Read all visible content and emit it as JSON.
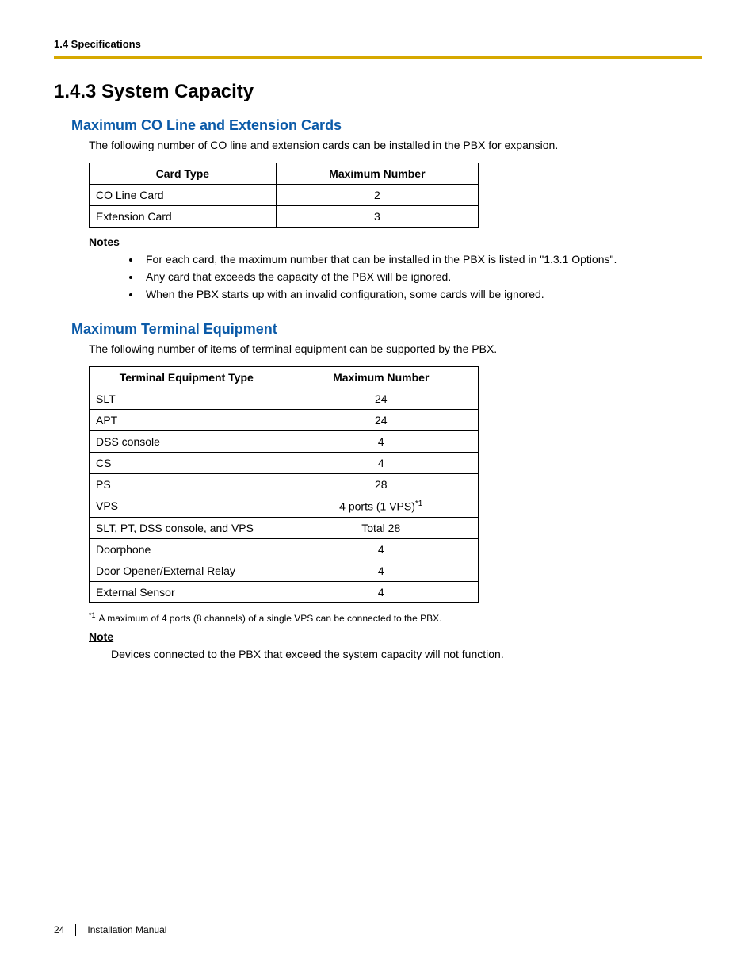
{
  "header": {
    "section": "1.4 Specifications"
  },
  "title": "1.4.3    System Capacity",
  "s1": {
    "title": "Maximum CO Line and Extension Cards",
    "intro": "The following number of CO line and extension cards can be installed in the PBX for expansion.",
    "table": {
      "h1": "Card Type",
      "h2": "Maximum Number",
      "rows": [
        {
          "label": "CO Line Card",
          "value": "2"
        },
        {
          "label": "Extension Card",
          "value": "3"
        }
      ]
    },
    "notes_label": "Notes",
    "notes": [
      "For each card, the maximum number that can be installed in the PBX is listed in \"1.3.1 Options\".",
      "Any card that exceeds the capacity of the PBX will be ignored.",
      "When the PBX starts up with an invalid configuration, some cards will be ignored."
    ]
  },
  "s2": {
    "title": "Maximum Terminal Equipment",
    "intro": "The following number of items of terminal equipment can be supported by the PBX.",
    "table": {
      "h1": "Terminal Equipment Type",
      "h2": "Maximum Number",
      "rows": [
        {
          "label": "SLT",
          "value": "24"
        },
        {
          "label": "APT",
          "value": "24"
        },
        {
          "label": "DSS console",
          "value": "4"
        },
        {
          "label": "CS",
          "value": "4"
        },
        {
          "label": "PS",
          "value": "28"
        },
        {
          "label": "VPS",
          "value": "4 ports (1 VPS)",
          "sup": "*1"
        },
        {
          "label": "SLT, PT, DSS console, and VPS",
          "value": "Total 28"
        },
        {
          "label": "Doorphone",
          "value": "4"
        },
        {
          "label": "Door Opener/External Relay",
          "value": "4"
        },
        {
          "label": "External Sensor",
          "value": "4"
        }
      ]
    },
    "footnote_mark": "*1",
    "footnote": "A maximum of 4 ports (8 channels) of a single VPS can be connected to the PBX.",
    "note_label": "Note",
    "note": "Devices connected to the PBX that exceed the system capacity will not function."
  },
  "footer": {
    "page": "24",
    "doc": "Installation Manual"
  }
}
